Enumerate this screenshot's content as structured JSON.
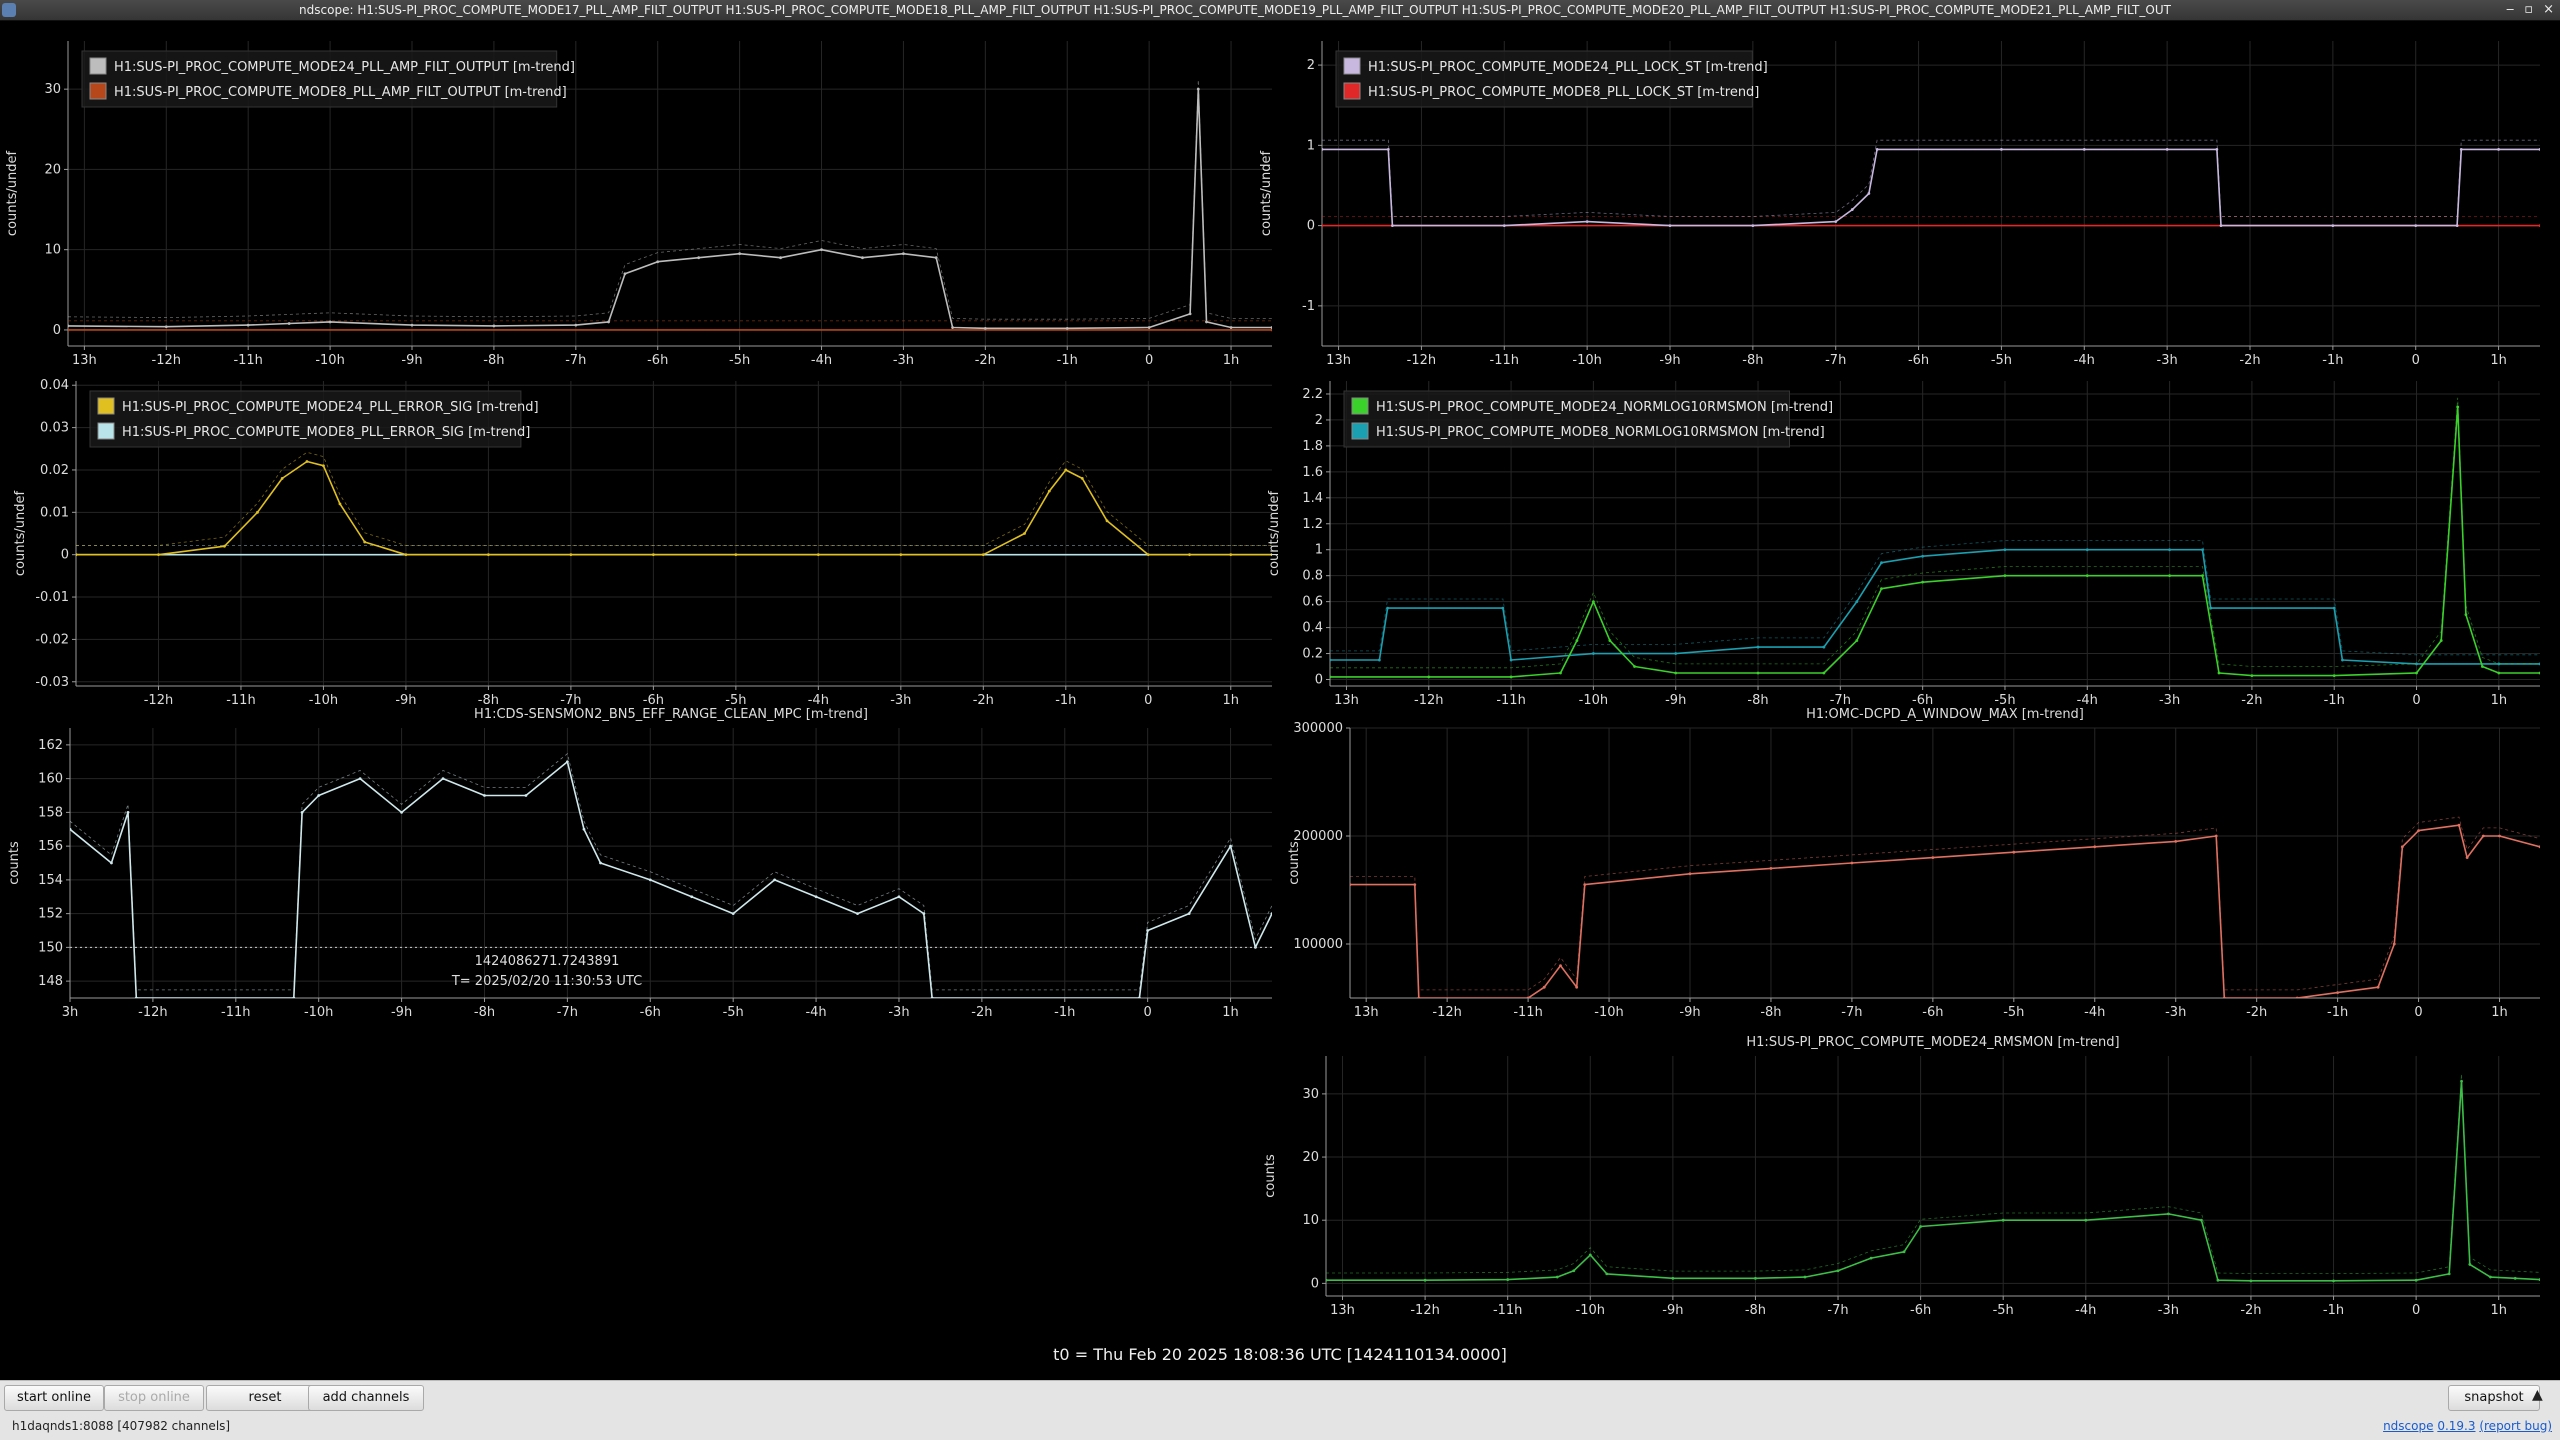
{
  "window": {
    "app_name": "ndscope",
    "title": "ndscope: H1:SUS-PI_PROC_COMPUTE_MODE17_PLL_AMP_FILT_OUTPUT H1:SUS-PI_PROC_COMPUTE_MODE18_PLL_AMP_FILT_OUTPUT H1:SUS-PI_PROC_COMPUTE_MODE19_PLL_AMP_FILT_OUTPUT H1:SUS-PI_PROC_COMPUTE_MODE20_PLL_AMP_FILT_OUTPUT H1:SUS-PI_PROC_COMPUTE_MODE21_PLL_AMP_FILT_OUT",
    "controls": [
      "‒",
      "▫",
      "×"
    ]
  },
  "colors": {
    "background": "#000000",
    "grid": "#2a2a2a",
    "axis_text": "#dddddd",
    "accent_link": "#1a5bd0"
  },
  "t0_label": "t0 = Thu Feb 20 2025 18:08:36 UTC [1424110134.0000]",
  "cursor": {
    "gps": "1424086271.7243891",
    "time": "T= 2025/02/20 11:30:53 UTC",
    "level_value": 150
  },
  "toolbar": {
    "start_online": "start online",
    "stop_online": "stop online",
    "reset": "reset",
    "add_channels": "add channels",
    "snapshot": "snapshot",
    "menu_icon": "caret-up-icon"
  },
  "status": {
    "server": "h1daqnds1:8088",
    "channels": "[407982 channels]",
    "version_prefix": "ndscope",
    "version": "0.19.3",
    "report_bug": "(report bug)"
  },
  "chart_data": [
    {
      "type": "line",
      "id": "p1",
      "title": "",
      "ylabel": "counts/undef",
      "ylim": [
        -2,
        36
      ],
      "yticks": [
        0,
        10,
        20,
        30
      ],
      "xlim": [
        -13.2,
        1.5
      ],
      "xticks": [
        -13,
        -12,
        -11,
        -10,
        -9,
        -8,
        -7,
        -6,
        -5,
        -4,
        -3,
        -2,
        -1,
        0,
        1
      ],
      "xtick_labels": [
        "13h",
        "-12h",
        "-11h",
        "-10h",
        "-9h",
        "-8h",
        "-7h",
        "-6h",
        "-5h",
        "-4h",
        "-3h",
        "-2h",
        "-1h",
        "0",
        "1h"
      ],
      "grid": true,
      "legend": "top-left",
      "series": [
        {
          "name": "H1:SUS-PI_PROC_COMPUTE_MODE24_PLL_AMP_FILT_OUTPUT [m-trend]",
          "color": "#bdbdbd",
          "x": [
            -13.2,
            -12,
            -11,
            -10.5,
            -10,
            -9,
            -8,
            -7,
            -6.6,
            -6.4,
            -6,
            -5.5,
            -5,
            -4.5,
            -4,
            -3.5,
            -3,
            -2.6,
            -2.4,
            -2,
            -1,
            0,
            0.5,
            0.6,
            0.7,
            1,
            1.5
          ],
          "y": [
            0.5,
            0.4,
            0.6,
            0.8,
            1.0,
            0.6,
            0.5,
            0.6,
            1.0,
            7.0,
            8.5,
            9.0,
            9.5,
            9.0,
            10.0,
            9.0,
            9.5,
            9.0,
            0.3,
            0.2,
            0.2,
            0.3,
            2.0,
            30.0,
            1.0,
            0.3,
            0.3
          ]
        },
        {
          "name": "H1:SUS-PI_PROC_COMPUTE_MODE8_PLL_AMP_FILT_OUTPUT [m-trend]",
          "color": "#b5471b",
          "x": [
            -13.2,
            1.5
          ],
          "y": [
            0,
            0
          ]
        }
      ]
    },
    {
      "type": "line",
      "id": "p2",
      "title": "",
      "ylabel": "counts/undef",
      "ylim": [
        -1.5,
        2.3
      ],
      "yticks": [
        -1,
        0,
        1,
        2
      ],
      "xlim": [
        -13.2,
        1.5
      ],
      "xticks": [
        -13,
        -12,
        -11,
        -10,
        -9,
        -8,
        -7,
        -6,
        -5,
        -4,
        -3,
        -2,
        -1,
        0,
        1
      ],
      "xtick_labels": [
        "13h",
        "-12h",
        "-11h",
        "-10h",
        "-9h",
        "-8h",
        "-7h",
        "-6h",
        "-5h",
        "-4h",
        "-3h",
        "-2h",
        "-1h",
        "0",
        "1h"
      ],
      "grid": true,
      "legend": "top-left",
      "series": [
        {
          "name": "H1:SUS-PI_PROC_COMPUTE_MODE24_PLL_LOCK_ST [m-trend]",
          "color": "#c8b8e0",
          "x": [
            -13.2,
            -12.4,
            -12.35,
            -11,
            -10,
            -9,
            -8,
            -7,
            -6.8,
            -6.6,
            -6.5,
            -5,
            -4,
            -3,
            -2.4,
            -2.35,
            -1,
            0,
            0.5,
            0.55,
            1,
            1.5
          ],
          "y": [
            0.95,
            0.95,
            0.0,
            0.0,
            0.05,
            0.0,
            0.0,
            0.05,
            0.2,
            0.4,
            0.95,
            0.95,
            0.95,
            0.95,
            0.95,
            0.0,
            0.0,
            0.0,
            0.0,
            0.95,
            0.95,
            0.95
          ]
        },
        {
          "name": "H1:SUS-PI_PROC_COMPUTE_MODE8_PLL_LOCK_ST [m-trend]",
          "color": "#e02828",
          "x": [
            -13.2,
            1.5
          ],
          "y": [
            0,
            0
          ]
        }
      ]
    },
    {
      "type": "line",
      "id": "p3",
      "title": "",
      "ylabel": "counts/undef",
      "ylim": [
        -0.031,
        0.041
      ],
      "yticks": [
        -0.03,
        -0.02,
        -0.01,
        0,
        0.01,
        0.02,
        0.03,
        0.04
      ],
      "xlim": [
        -13.0,
        1.5
      ],
      "xticks": [
        -12,
        -11,
        -10,
        -9,
        -8,
        -7,
        -6,
        -5,
        -4,
        -3,
        -2,
        -1,
        0,
        1
      ],
      "xtick_labels": [
        "-12h",
        "-11h",
        "-10h",
        "-9h",
        "-8h",
        "-7h",
        "-6h",
        "-5h",
        "-4h",
        "-3h",
        "-2h",
        "-1h",
        "0",
        "1h"
      ],
      "grid": true,
      "legend": "top-left",
      "series": [
        {
          "name": "H1:SUS-PI_PROC_COMPUTE_MODE24_PLL_ERROR_SIG [m-trend]",
          "color": "#e0c020",
          "x": [
            -13.0,
            -12,
            -11.2,
            -10.8,
            -10.5,
            -10.2,
            -10.0,
            -9.8,
            -9.5,
            -9,
            -8,
            -7,
            -6,
            -5,
            -4,
            -3,
            -2,
            -1.5,
            -1.2,
            -1.0,
            -0.8,
            -0.5,
            0,
            0.5,
            1,
            1.5
          ],
          "y": [
            0,
            0,
            0.002,
            0.01,
            0.018,
            0.022,
            0.021,
            0.012,
            0.003,
            0,
            0,
            0,
            0,
            0,
            0,
            0,
            0,
            0.005,
            0.015,
            0.02,
            0.018,
            0.008,
            0,
            0,
            0,
            0
          ]
        },
        {
          "name": "H1:SUS-PI_PROC_COMPUTE_MODE8_PLL_ERROR_SIG [m-trend]",
          "color": "#b8e4ea",
          "x": [
            -13.0,
            1.5
          ],
          "y": [
            0,
            0
          ]
        }
      ]
    },
    {
      "type": "line",
      "id": "p4",
      "title": "",
      "ylabel": "counts/undef",
      "ylim": [
        -0.05,
        2.3
      ],
      "yticks": [
        0,
        0.2,
        0.4,
        0.6,
        0.8,
        1,
        1.2,
        1.4,
        1.6,
        1.8,
        2,
        2.2
      ],
      "ytick_labels": [
        "0",
        "0.2",
        "0.4",
        "0.6",
        "0.8",
        "1",
        "1.2",
        "1.4",
        "1.6",
        "1.8",
        "2",
        "2.2"
      ],
      "xlim": [
        -13.2,
        1.5
      ],
      "xticks": [
        -13,
        -12,
        -11,
        -10,
        -9,
        -8,
        -7,
        -6,
        -5,
        -4,
        -3,
        -2,
        -1,
        0,
        1
      ],
      "xtick_labels": [
        "13h",
        "-12h",
        "-11h",
        "-10h",
        "-9h",
        "-8h",
        "-7h",
        "-6h",
        "-5h",
        "-4h",
        "-3h",
        "-2h",
        "-1h",
        "0",
        "1h"
      ],
      "grid": true,
      "legend": "top-left",
      "series": [
        {
          "name": "H1:SUS-PI_PROC_COMPUTE_MODE24_NORMLOG10RMSMON [m-trend]",
          "color": "#3ad12a",
          "x": [
            -13.2,
            -12,
            -11,
            -10.4,
            -10.2,
            -10.0,
            -9.8,
            -9.5,
            -9,
            -8,
            -7.2,
            -6.8,
            -6.5,
            -6,
            -5,
            -4,
            -3,
            -2.6,
            -2.4,
            -2,
            -1,
            0,
            0.3,
            0.5,
            0.6,
            0.8,
            1,
            1.5
          ],
          "y": [
            0.02,
            0.02,
            0.02,
            0.05,
            0.3,
            0.6,
            0.3,
            0.1,
            0.05,
            0.05,
            0.05,
            0.3,
            0.7,
            0.75,
            0.8,
            0.8,
            0.8,
            0.8,
            0.05,
            0.03,
            0.03,
            0.05,
            0.3,
            2.1,
            0.5,
            0.1,
            0.05,
            0.05
          ]
        },
        {
          "name": "H1:SUS-PI_PROC_COMPUTE_MODE8_NORMLOG10RMSMON [m-trend]",
          "color": "#1aa0b0",
          "x": [
            -13.2,
            -12.6,
            -12.5,
            -11.1,
            -11.0,
            -10,
            -9,
            -8,
            -7.2,
            -6.8,
            -6.5,
            -6,
            -5,
            -4,
            -3,
            -2.6,
            -2.5,
            -1.0,
            -0.9,
            0,
            1,
            1.5
          ],
          "y": [
            0.15,
            0.15,
            0.55,
            0.55,
            0.15,
            0.2,
            0.2,
            0.25,
            0.25,
            0.6,
            0.9,
            0.95,
            1.0,
            1.0,
            1.0,
            1.0,
            0.55,
            0.55,
            0.15,
            0.12,
            0.12,
            0.12
          ]
        }
      ]
    },
    {
      "type": "line",
      "id": "p5",
      "title": "H1:CDS-SENSMON2_BN5_EFF_RANGE_CLEAN_MPC [m-trend]",
      "ylabel": "counts",
      "ylim": [
        147,
        163
      ],
      "yticks": [
        148,
        150,
        152,
        154,
        156,
        158,
        160,
        162
      ],
      "xlim": [
        -13.0,
        1.5
      ],
      "xticks": [
        -13,
        -12,
        -11,
        -10,
        -9,
        -8,
        -7,
        -6,
        -5,
        -4,
        -3,
        -2,
        -1,
        0,
        1
      ],
      "xtick_labels": [
        "3h",
        "-12h",
        "-11h",
        "-10h",
        "-9h",
        "-8h",
        "-7h",
        "-6h",
        "-5h",
        "-4h",
        "-3h",
        "-2h",
        "-1h",
        "0",
        "1h"
      ],
      "grid": true,
      "legend": "none",
      "series": [
        {
          "name": "",
          "color": "#cfe8ec",
          "x": [
            -13.0,
            -12.5,
            -12.3,
            -12.2,
            -10.3,
            -10.2,
            -10.0,
            -9.5,
            -9,
            -8.5,
            -8,
            -7.5,
            -7.0,
            -6.8,
            -6.6,
            -6.0,
            -5.5,
            -5,
            -4.5,
            -4,
            -3.5,
            -3.0,
            -2.7,
            -2.6,
            -0.1,
            0,
            0.5,
            1.0,
            1.3,
            1.5
          ],
          "y": [
            157,
            155,
            158,
            147,
            147,
            158,
            159,
            160,
            158,
            160,
            159,
            159,
            161,
            157,
            155,
            154,
            153,
            152,
            154,
            153,
            152,
            153,
            152,
            147,
            147,
            151,
            152,
            156,
            150,
            152
          ]
        }
      ]
    },
    {
      "type": "line",
      "id": "p6",
      "title": "H1:OMC-DCPD_A_WINDOW_MAX [m-trend]",
      "ylabel": "counts",
      "ylim": [
        50000,
        300000
      ],
      "yticks": [
        100000,
        200000,
        300000
      ],
      "xlim": [
        -13.2,
        1.5
      ],
      "xticks": [
        -13,
        -12,
        -11,
        -10,
        -9,
        -8,
        -7,
        -6,
        -5,
        -4,
        -3,
        -2,
        -1,
        0,
        1
      ],
      "xtick_labels": [
        "13h",
        "-12h",
        "-11h",
        "-10h",
        "-9h",
        "-8h",
        "-7h",
        "-6h",
        "-5h",
        "-4h",
        "-3h",
        "-2h",
        "-1h",
        "0",
        "1h"
      ],
      "grid": true,
      "legend": "none",
      "series": [
        {
          "name": "",
          "color": "#e07060",
          "x": [
            -13.2,
            -12.4,
            -12.35,
            -11.0,
            -10.8,
            -10.6,
            -10.4,
            -10.3,
            -9,
            -8,
            -7,
            -6,
            -5,
            -4,
            -3,
            -2.5,
            -2.4,
            -1.5,
            -1.0,
            -0.5,
            -0.3,
            -0.2,
            0,
            0.5,
            0.6,
            0.8,
            1,
            1.5
          ],
          "y": [
            155000,
            155000,
            50000,
            50000,
            60000,
            80000,
            60000,
            155000,
            165000,
            170000,
            175000,
            180000,
            185000,
            190000,
            195000,
            200000,
            50000,
            50000,
            55000,
            60000,
            100000,
            190000,
            205000,
            210000,
            180000,
            200000,
            200000,
            190000
          ]
        }
      ]
    },
    {
      "type": "line",
      "id": "p7",
      "title": "H1:SUS-PI_PROC_COMPUTE_MODE24_RMSMON [m-trend]",
      "ylabel": "counts",
      "ylim": [
        -2,
        36
      ],
      "yticks": [
        0,
        10,
        20,
        30
      ],
      "xlim": [
        -13.2,
        1.5
      ],
      "xticks": [
        -13,
        -12,
        -11,
        -10,
        -9,
        -8,
        -7,
        -6,
        -5,
        -4,
        -3,
        -2,
        -1,
        0,
        1
      ],
      "xtick_labels": [
        "13h",
        "-12h",
        "-11h",
        "-10h",
        "-9h",
        "-8h",
        "-7h",
        "-6h",
        "-5h",
        "-4h",
        "-3h",
        "-2h",
        "-1h",
        "0",
        "1h"
      ],
      "grid": true,
      "legend": "none",
      "series": [
        {
          "name": "",
          "color": "#3bbf46",
          "x": [
            -13.2,
            -12,
            -11,
            -10.4,
            -10.2,
            -10.0,
            -9.8,
            -9,
            -8,
            -7.4,
            -7,
            -6.6,
            -6.2,
            -6,
            -5,
            -4,
            -3,
            -2.6,
            -2.4,
            -2,
            -1,
            0,
            0.4,
            0.55,
            0.65,
            0.9,
            1.2,
            1.5
          ],
          "y": [
            0.5,
            0.5,
            0.6,
            1.0,
            2.0,
            4.5,
            1.5,
            0.8,
            0.8,
            1.0,
            2.0,
            4.0,
            5.0,
            9.0,
            10.0,
            10.0,
            11.0,
            10.0,
            0.5,
            0.4,
            0.4,
            0.5,
            1.5,
            32.0,
            3.0,
            1.0,
            0.8,
            0.6
          ]
        }
      ]
    }
  ]
}
